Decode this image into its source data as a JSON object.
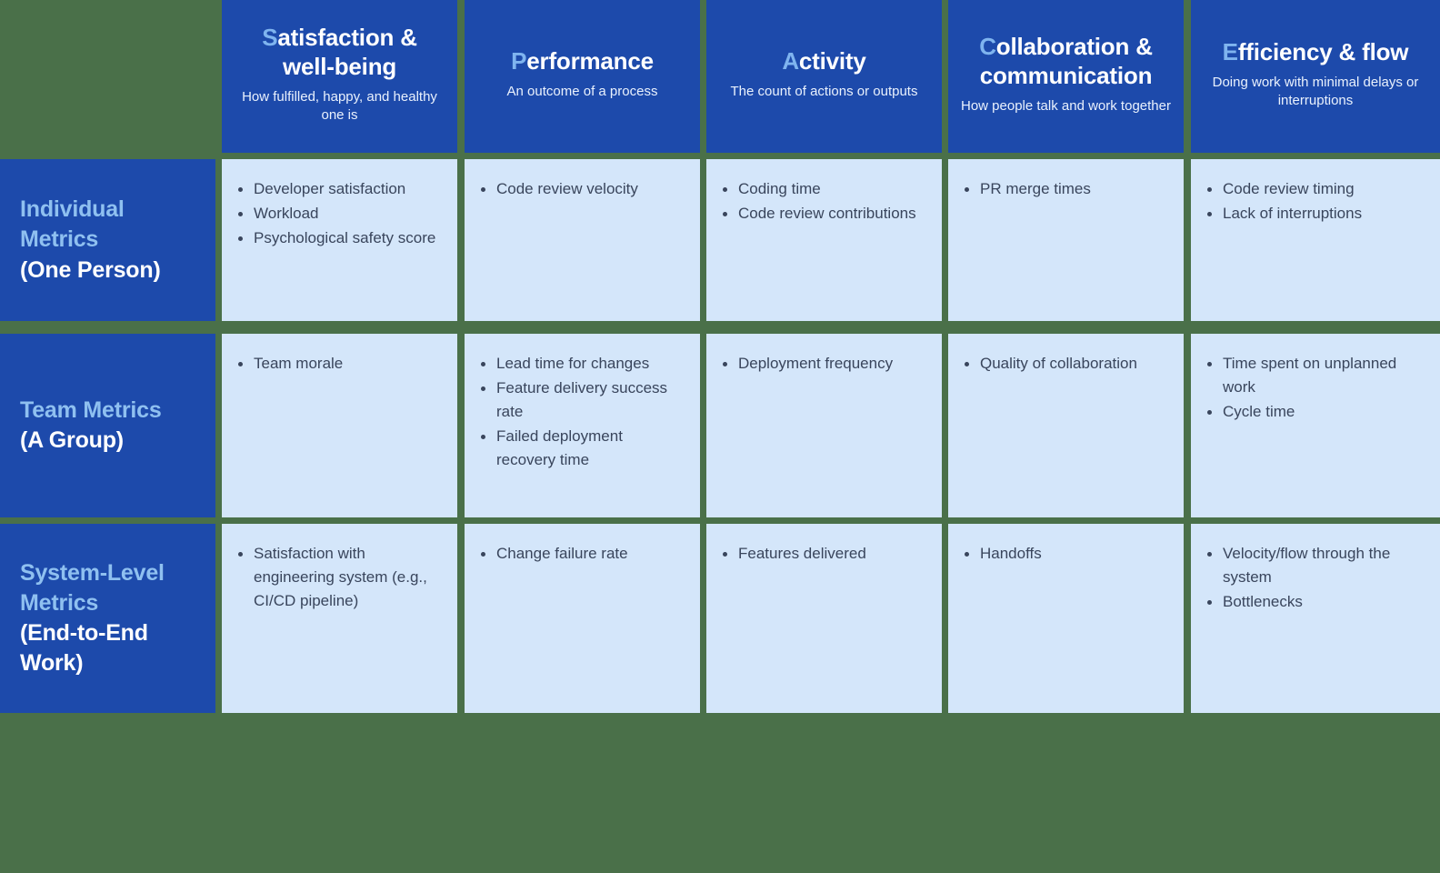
{
  "meta": {
    "colors": {
      "page_background": "#4a7049",
      "header_blue": "#1d4aab",
      "cell_blue": "#d4e6fa",
      "accent_light_blue": "#7fb4ef",
      "row_label_accent": "#8fc0f0",
      "body_text": "#39455c",
      "header_text": "#ffffff"
    }
  },
  "columns": [
    {
      "id": "satisfaction",
      "lead": "S",
      "title_rest": "atisfaction & well-being",
      "title_full": "Satisfaction & well-being",
      "subtitle": "How fulfilled, happy, and healthy one is"
    },
    {
      "id": "performance",
      "lead": "P",
      "title_rest": "erformance",
      "title_full": "Performance",
      "subtitle": "An outcome of a process"
    },
    {
      "id": "activity",
      "lead": "A",
      "title_rest": "ctivity",
      "title_full": "Activity",
      "subtitle": "The count of actions or outputs"
    },
    {
      "id": "collaboration",
      "lead": "C",
      "title_rest": "ollaboration & communication",
      "title_full": "Collaboration & communication",
      "subtitle": "How people talk and work together"
    },
    {
      "id": "efficiency",
      "lead": "E",
      "title_rest": "fficiency & flow",
      "title_full": "Efficiency & flow",
      "subtitle": "Doing work with minimal delays or interruptions"
    }
  ],
  "rows": [
    {
      "id": "individual",
      "label_main": "Individual Metrics",
      "label_sub": "(One Person)",
      "cells": [
        [
          "Developer satisfaction",
          "Workload",
          "Psychological safety score"
        ],
        [
          "Code review velocity"
        ],
        [
          "Coding time",
          "Code review contributions"
        ],
        [
          "PR merge times"
        ],
        [
          "Code review timing",
          "Lack of interruptions"
        ]
      ]
    },
    {
      "id": "team",
      "label_main": "Team Metrics",
      "label_sub": "(A Group)",
      "cells": [
        [
          "Team morale"
        ],
        [
          "Lead time for changes",
          "Feature delivery success rate",
          "Failed deployment recovery time"
        ],
        [
          "Deployment frequency"
        ],
        [
          "Quality of collaboration"
        ],
        [
          "Time spent on unplanned work",
          "Cycle time"
        ]
      ]
    },
    {
      "id": "system",
      "label_main": "System-Level Metrics",
      "label_sub": "(End-to-End Work)",
      "cells": [
        [
          "Satisfaction with engineering system (e.g., CI/CD pipeline)"
        ],
        [
          "Change failure rate"
        ],
        [
          "Features delivered"
        ],
        [
          "Handoffs"
        ],
        [
          "Velocity/flow through the system",
          "Bottlenecks"
        ]
      ]
    }
  ]
}
